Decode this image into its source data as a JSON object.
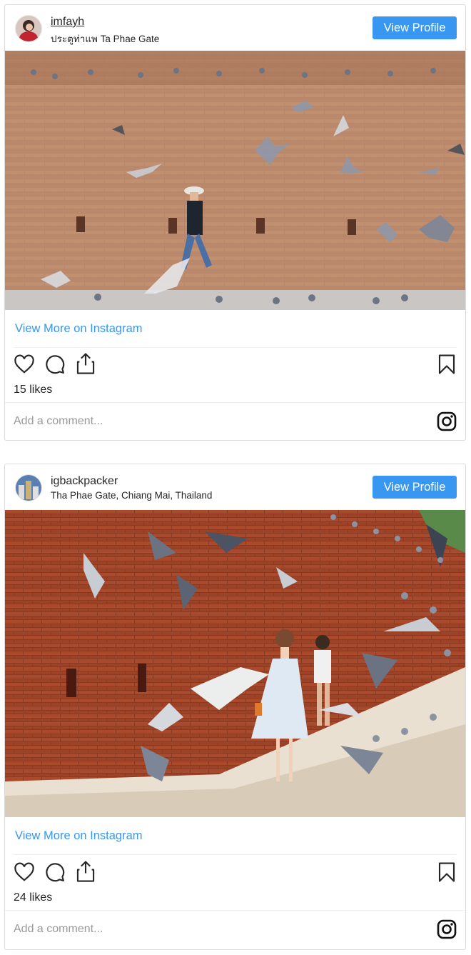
{
  "posts": [
    {
      "username": "imfayh",
      "location": "ประตูท่าแพ Ta Phae Gate",
      "view_profile_label": "View Profile",
      "view_more_label": "View More on Instagram",
      "likes": "15 likes",
      "comment_placeholder": "Add a comment...",
      "photo_alt": "Woman in hat walking past brick wall with flying pigeons"
    },
    {
      "username": "igbackpacker",
      "location": "Tha Phae Gate, Chiang Mai, Thailand",
      "view_profile_label": "View Profile",
      "view_more_label": "View More on Instagram",
      "likes": "24 likes",
      "comment_placeholder": "Add a comment...",
      "photo_alt": "Woman in white dress surrounded by pigeons at red brick wall"
    }
  ],
  "colors": {
    "accent": "#3897f0",
    "border": "#dbdbdb",
    "text": "#262626",
    "placeholder": "#999999"
  },
  "icons": [
    "heart-icon",
    "comment-icon",
    "share-icon",
    "bookmark-icon",
    "instagram-logo-icon"
  ]
}
